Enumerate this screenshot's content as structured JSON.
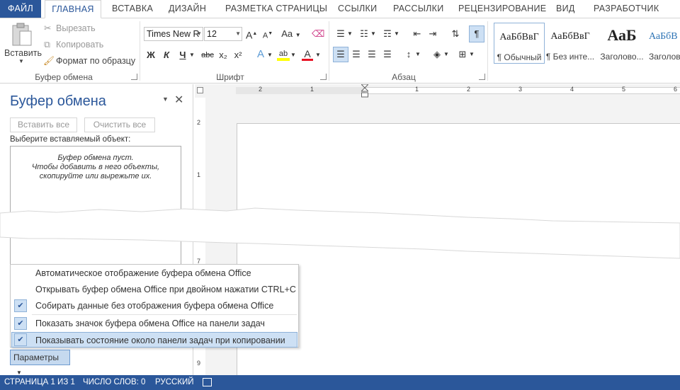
{
  "tabs": {
    "file": "ФАЙЛ",
    "home": "ГЛАВНАЯ",
    "insert": "ВСТАВКА",
    "design": "ДИЗАЙН",
    "layout": "РАЗМЕТКА СТРАНИЦЫ",
    "references": "ССЫЛКИ",
    "mailings": "РАССЫЛКИ",
    "review": "РЕЦЕНЗИРОВАНИЕ",
    "view": "ВИД",
    "developer": "РАЗРАБОТЧИК"
  },
  "clipboard_group": {
    "paste": "Вставить",
    "cut": "Вырезать",
    "copy": "Копировать",
    "format_painter": "Формат по образцу",
    "label": "Буфер обмена"
  },
  "font_group": {
    "font_name": "Times New R",
    "font_size": "12",
    "label": "Шрифт",
    "grow": "A",
    "shrink": "A",
    "case": "Aa",
    "bold": "Ж",
    "italic": "К",
    "underline": "Ч",
    "strike": "abc",
    "subscript": "x₂",
    "superscript": "x²",
    "effects": "A",
    "highlight": "ab",
    "font_color": "A"
  },
  "paragraph_group": {
    "label": "Абзац",
    "pilcrow": "¶"
  },
  "styles_group": {
    "styles": [
      {
        "sample": "АаБбВвГ",
        "name": "¶ Обычный"
      },
      {
        "sample": "АаБбВвГ",
        "name": "¶ Без инте..."
      },
      {
        "sample": "АаБ",
        "name": "Заголово..."
      },
      {
        "sample": "АаБбВ",
        "name": "Заголово..."
      }
    ]
  },
  "pane": {
    "title": "Буфер обмена",
    "paste_all": "Вставить все",
    "clear_all": "Очистить все",
    "select_prompt": "Выберите вставляемый объект:",
    "empty_line1": "Буфер обмена пуст.",
    "empty_line2": "Чтобы добавить в него объекты,",
    "empty_line3": "скопируйте или вырежьте их.",
    "options_button": "Параметры"
  },
  "options_menu": [
    {
      "label": "Автоматическое отображение буфера обмена Office",
      "checked": false
    },
    {
      "label": "Открывать буфер обмена Office при двойном нажатии CTRL+C",
      "checked": false
    },
    {
      "label": "Собирать данные без отображения буфера обмена Office",
      "checked": true
    },
    {
      "label": "Показать значок буфера обмена Office на панели задач",
      "checked": true
    },
    {
      "label": "Показывать состояние около панели задач при копировании",
      "checked": true,
      "highlighted": true
    }
  ],
  "ruler": {
    "h_numbers": [
      "2",
      "1",
      "1",
      "2",
      "3",
      "4",
      "5",
      "6"
    ],
    "v_numbers": [
      "2",
      "1",
      "7",
      "9"
    ]
  },
  "status": {
    "page": "СТРАНИЦА 1 ИЗ 1",
    "words": "ЧИСЛО СЛОВ: 0",
    "language": "РУССКИЙ"
  },
  "colors": {
    "accent": "#2b579a",
    "highlight": "#cde0f4",
    "font_color_bar": "#e81123",
    "highlight_bar": "#ffff00"
  }
}
